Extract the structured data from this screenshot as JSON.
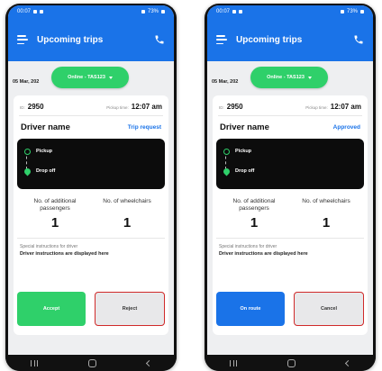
{
  "phones": [
    {
      "statusbar": {
        "time": "00:07",
        "right": "73%"
      },
      "appbar": {
        "title": "Upcoming trips",
        "menu_icon": "menu-icon",
        "call_icon": "phone-icon"
      },
      "date": "05 Mar, 202",
      "online_pill": "Online - TAS123",
      "trip": {
        "id_prefix": "ID:",
        "id": "2950",
        "pickup_label": "Pickup time:",
        "pickup_time": "12:07 am",
        "driver_name": "Driver name",
        "status": "Trip request",
        "stops": [
          "Pickup",
          "Drop off"
        ],
        "passengers_label": "No. of additional passengers",
        "passengers_value": "1",
        "wheelchairs_label": "No. of wheelchairs",
        "wheelchairs_value": "1",
        "instructions_title": "Special instructions for driver",
        "instructions_text": "Driver instructions are displayed here"
      },
      "buttons": {
        "primary": "Accept",
        "secondary": "Reject"
      }
    },
    {
      "statusbar": {
        "time": "00:07",
        "right": "73%"
      },
      "appbar": {
        "title": "Upcoming trips",
        "menu_icon": "menu-icon",
        "call_icon": "phone-icon"
      },
      "date": "05 Mar, 202",
      "online_pill": "Online - TAS123",
      "trip": {
        "id_prefix": "ID:",
        "id": "2950",
        "pickup_label": "Pickup time:",
        "pickup_time": "12:07 am",
        "driver_name": "Driver name",
        "status": "Approved",
        "stops": [
          "Pickup",
          "Drop off"
        ],
        "passengers_label": "No. of additional passengers",
        "passengers_value": "1",
        "wheelchairs_label": "No. of wheelchairs",
        "wheelchairs_value": "1",
        "instructions_title": "Special instructions for driver",
        "instructions_text": "Driver instructions are displayed here"
      },
      "buttons": {
        "primary": "On route",
        "secondary": "Cancel"
      }
    }
  ],
  "colors": {
    "brand": "#1a73e8",
    "online_green": "#2fd06a",
    "highlight_red": "#d02a2a"
  }
}
